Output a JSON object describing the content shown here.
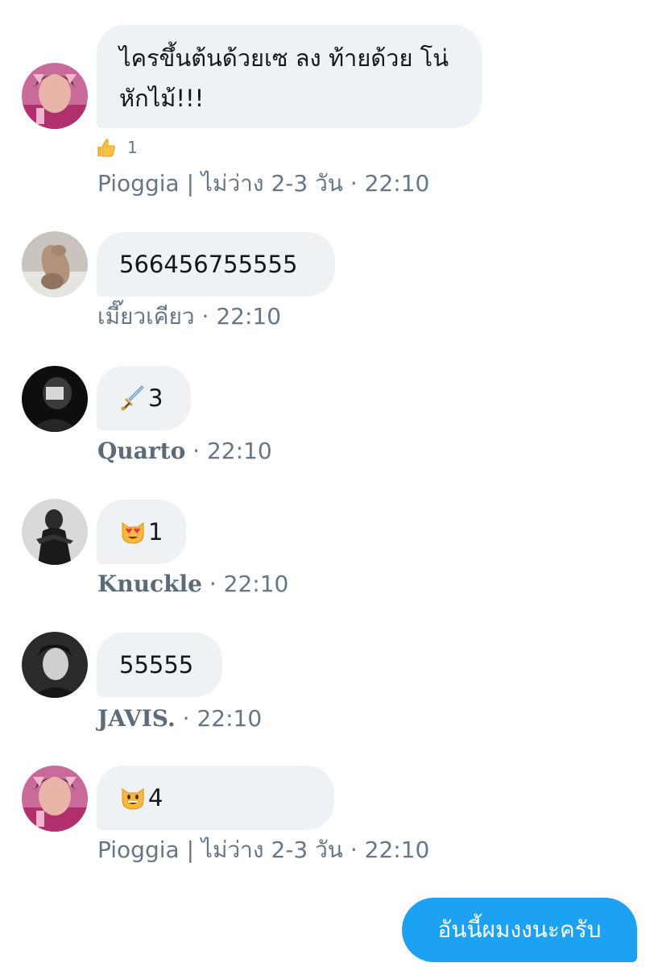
{
  "messages": [
    {
      "text": "ไครขึ้นต้นด้วยเซ ลง ท้ายด้วย โน่ หักไม้!!!",
      "reaction": {
        "icon": "thumbs-up-icon",
        "count": "1"
      },
      "sender": "Pioggia | ไม่ว่าง 2-3 วัน",
      "time": "22:10"
    },
    {
      "text": "566456755555",
      "sender": "เมี๊ยวเคียว",
      "time": "22:10"
    },
    {
      "emoji": "dagger-icon",
      "text": "3",
      "sender": "Quarto",
      "time": "22:10"
    },
    {
      "emoji": "heart-eyes-cat-icon",
      "text": "1",
      "sender": "Knuckle",
      "time": "22:10"
    },
    {
      "text": "55555",
      "sender": "JAVIS.",
      "time": "22:10"
    },
    {
      "emoji": "grinning-cat-icon",
      "text": "4",
      "sender": "Pioggia | ไม่ว่าง 2-3 วัน",
      "time": "22:10"
    }
  ],
  "own_message": {
    "text": "อันนี้ผมงงนะครับ"
  },
  "separator": "·",
  "colors": {
    "bubble_bg": "#eff2f4",
    "own_bubble_bg": "#1da1f2",
    "meta_text": "#657786"
  }
}
